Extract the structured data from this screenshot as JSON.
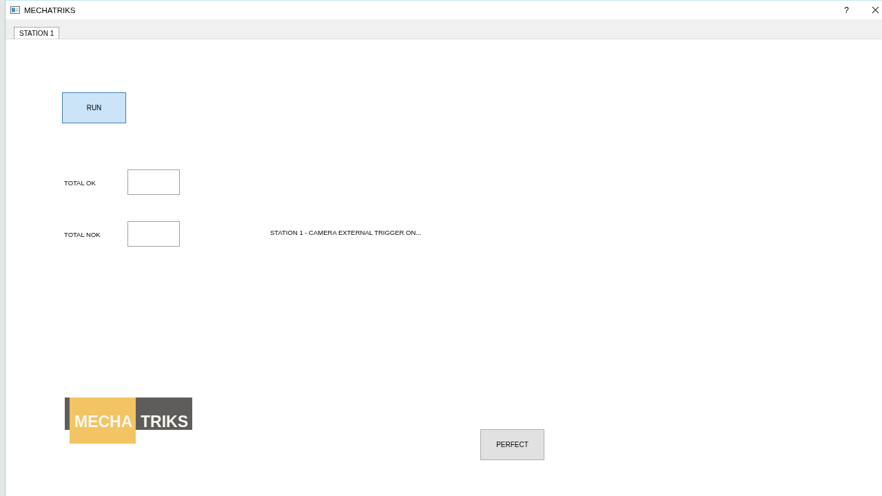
{
  "window": {
    "title": "MECHATRIKS",
    "help": "?"
  },
  "tabs": [
    {
      "label": "STATION 1",
      "selected": true
    }
  ],
  "run_button": "RUN",
  "counters": [
    {
      "label": "TOTAL OK"
    },
    {
      "label": "TOTAL NOK"
    }
  ],
  "status_message": "STATION 1 - CAMERA EXTERNAL TRIGGER ON...",
  "logo": {
    "words": [
      "MECHA",
      "TRIKS"
    ]
  },
  "perfect_button": "PERFECT"
}
